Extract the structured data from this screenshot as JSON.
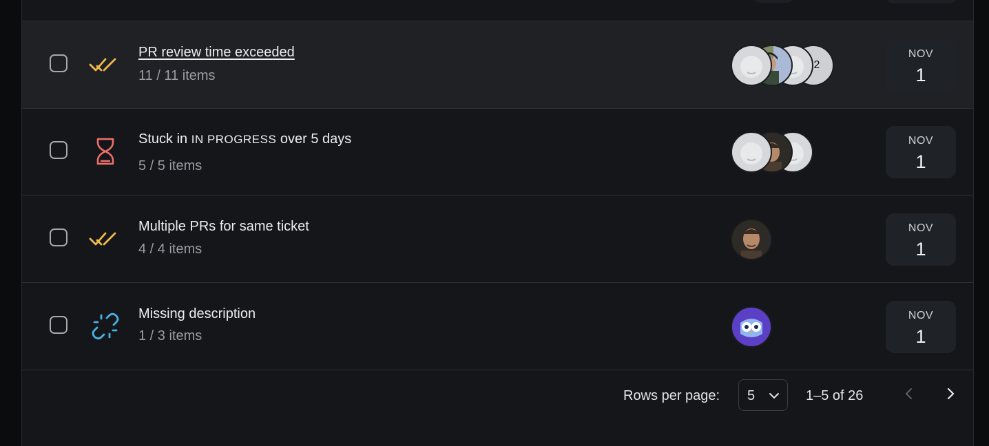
{
  "rows": [
    {
      "title": "PR review time exceeded",
      "count": "11 / 11 items",
      "icon": "double-check-icon",
      "more_count": "2",
      "month": "NOV",
      "day": "1"
    },
    {
      "title_prefix": "Stuck in",
      "title_status": "IN PROGRESS",
      "title_suffix": "over 5 days",
      "count": "5 / 5 items",
      "icon": "hourglass-icon",
      "month": "NOV",
      "day": "1"
    },
    {
      "title": "Multiple PRs for same ticket",
      "count": "4 / 4 items",
      "icon": "double-check-icon",
      "month": "NOV",
      "day": "1"
    },
    {
      "title": "Missing description",
      "count": "1 / 3 items",
      "icon": "broken-link-icon",
      "month": "NOV",
      "day": "1"
    }
  ],
  "pagination": {
    "rows_per_page_label": "Rows per page:",
    "rows_per_page_value": "5",
    "range": "1–5 of 26"
  },
  "colors": {
    "check_icon": "#f2b84b",
    "hourglass_icon": "#ee6f6c",
    "link_icon": "#46b3e6",
    "owl_avatar_bg": "#5b3fc4"
  }
}
